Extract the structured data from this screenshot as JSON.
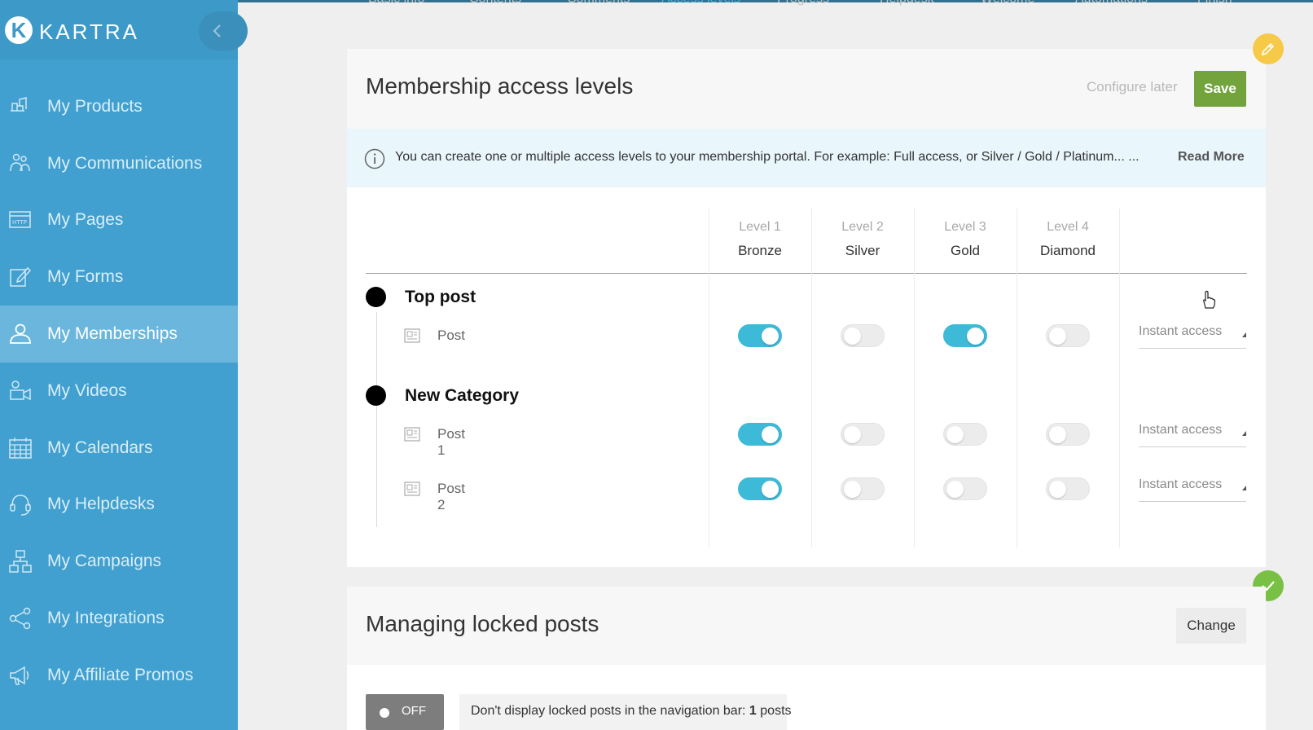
{
  "sidebar": {
    "logo_text": "KARTRA",
    "logo_mark": "K",
    "items": [
      {
        "label": "My Products",
        "icon": "products-icon"
      },
      {
        "label": "My Communications",
        "icon": "communications-icon"
      },
      {
        "label": "My Pages",
        "icon": "pages-icon"
      },
      {
        "label": "My Forms",
        "icon": "forms-icon"
      },
      {
        "label": "My Memberships",
        "icon": "memberships-icon",
        "active": true
      },
      {
        "label": "My Videos",
        "icon": "videos-icon"
      },
      {
        "label": "My Calendars",
        "icon": "calendars-icon"
      },
      {
        "label": "My Helpdesks",
        "icon": "helpdesks-icon"
      },
      {
        "label": "My Campaigns",
        "icon": "campaigns-icon"
      },
      {
        "label": "My Integrations",
        "icon": "integrations-icon"
      },
      {
        "label": "My Affiliate Promos",
        "icon": "affiliate-promos-icon"
      }
    ]
  },
  "tabs": [
    "Basic info",
    "Contents",
    "Comments",
    "Access levels",
    "Progress",
    "Helpdesk",
    "Welcome",
    "Automations",
    "Finish"
  ],
  "active_tab": "Access levels",
  "access_card": {
    "title": "Membership access levels",
    "configure_later": "Configure later",
    "save_label": "Save",
    "info_text": "You can create one or multiple access levels to your membership portal. For example: Full access, or Silver / Gold / Platinum... ...",
    "read_more": "Read More",
    "levels": [
      {
        "level": "Level 1",
        "name": "Bronze"
      },
      {
        "level": "Level 2",
        "name": "Silver"
      },
      {
        "level": "Level 3",
        "name": "Gold"
      },
      {
        "level": "Level 4",
        "name": "Diamond"
      }
    ],
    "categories": [
      {
        "name": "Top post",
        "posts": [
          {
            "name": "Post",
            "toggles": [
              true,
              false,
              true,
              false
            ],
            "access": "Instant access"
          }
        ]
      },
      {
        "name": "New Category",
        "posts": [
          {
            "name": "Post 1",
            "toggles": [
              true,
              false,
              false,
              false
            ],
            "access": "Instant access"
          },
          {
            "name": "Post 2",
            "toggles": [
              true,
              false,
              false,
              false
            ],
            "access": "Instant access"
          }
        ]
      }
    ]
  },
  "locked_card": {
    "title": "Managing locked posts",
    "change_label": "Change",
    "toggle_state": "OFF",
    "note_prefix": "Don't display locked posts in the navigation bar: ",
    "note_count": "1",
    "note_suffix": " posts"
  },
  "colors": {
    "sidebar": "#41a0cf",
    "sidebar_active": "#6bb6dc",
    "save_button": "#72a33c",
    "toggle_on": "#3cbad8",
    "edit_badge": "#f7c948",
    "check_badge": "#79c145"
  }
}
